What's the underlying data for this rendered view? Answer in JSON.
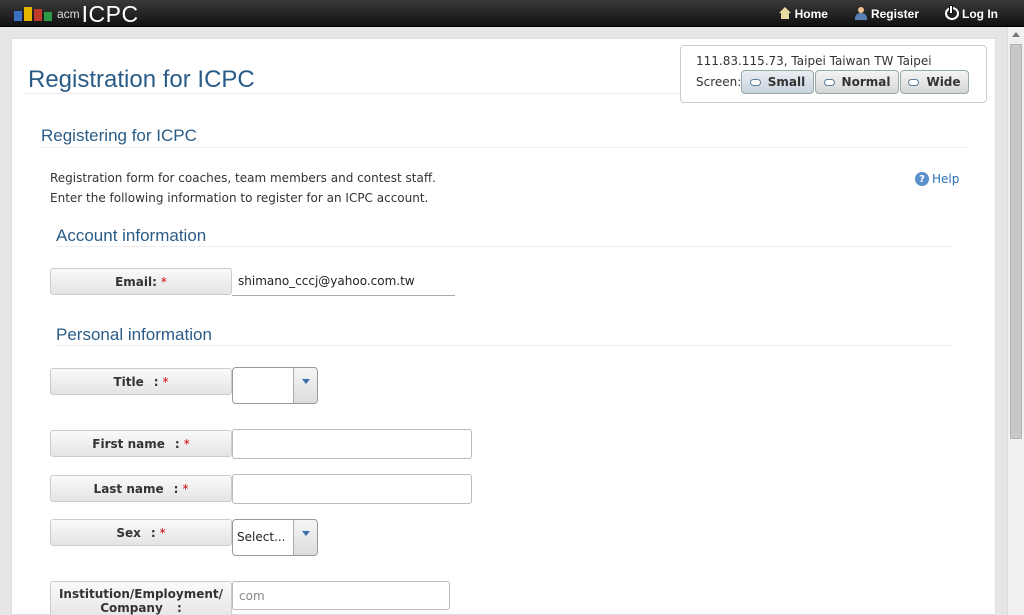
{
  "topbar": {
    "logo_acm": "acm",
    "logo_icpc": "ICPC",
    "nav": [
      {
        "label": "Home",
        "icon": "home-icon"
      },
      {
        "label": "Register",
        "icon": "user-icon"
      },
      {
        "label": "Log In",
        "icon": "power-icon"
      }
    ]
  },
  "page": {
    "title": "Registration for ICPC",
    "info": {
      "location": "111.83.115.73, Taipei Taiwan TW Taipei",
      "screen_label": "Screen:",
      "buttons": [
        "Small",
        "Normal",
        "Wide"
      ]
    },
    "section_title": "Registering for ICPC",
    "description": [
      "Registration form for coaches, team members and contest staff.",
      "Enter the following information to register for an ICPC account."
    ],
    "help_label": "Help",
    "account": {
      "heading": "Account information",
      "email_label": "Email:",
      "required_mark": "*",
      "email_value": "shimano_cccj@yahoo.com.tw"
    },
    "personal": {
      "heading": "Personal information",
      "title_label": "Title",
      "title_value": "",
      "firstname_label": "First name",
      "firstname_value": "",
      "lastname_label": "Last name",
      "lastname_value": "",
      "sex_label": "Sex",
      "sex_value": "Select...",
      "institution_label": "Institution/Employment/ Company",
      "institution_value": "com",
      "colon": ":",
      "required_mark": "*"
    }
  }
}
